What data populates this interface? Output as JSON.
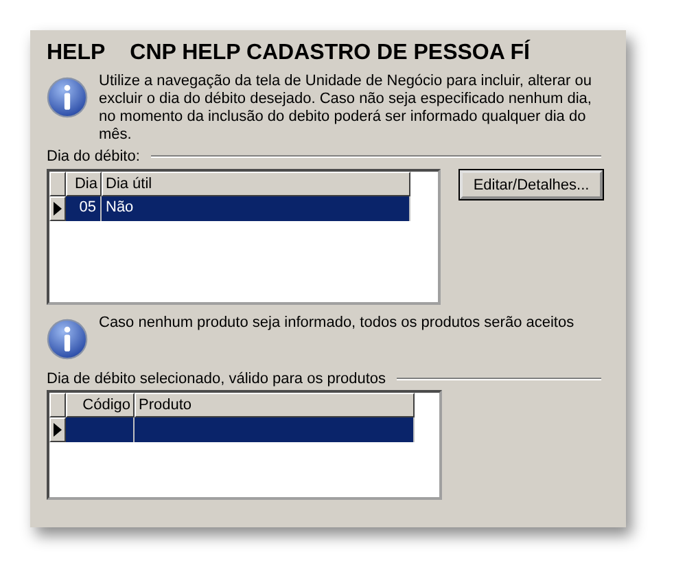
{
  "header": {
    "label": "HELP",
    "title": "CNP HELP CADASTRO DE PESSOA FÍ"
  },
  "info_top": "Utilize a navegação da tela de Unidade de Negócio para incluir, alterar ou excluir o dia do débito desejado. Caso não seja especificado nenhum dia, no momento da inclusão do debito poderá ser informado qualquer dia do mês.",
  "debit_day": {
    "label": "Dia do débito:",
    "columns": [
      "Dia",
      "Dia útil"
    ],
    "rows": [
      {
        "cells": [
          "05",
          "Não"
        ],
        "selected": true
      }
    ],
    "button": "Editar/Detalhes..."
  },
  "info_products": "Caso nenhum produto seja informado, todos os produtos serão aceitos",
  "products": {
    "label": "Dia de débito selecionado, válido para os produtos",
    "columns": [
      "Código",
      "Produto"
    ],
    "rows": [
      {
        "selected": true
      }
    ]
  }
}
